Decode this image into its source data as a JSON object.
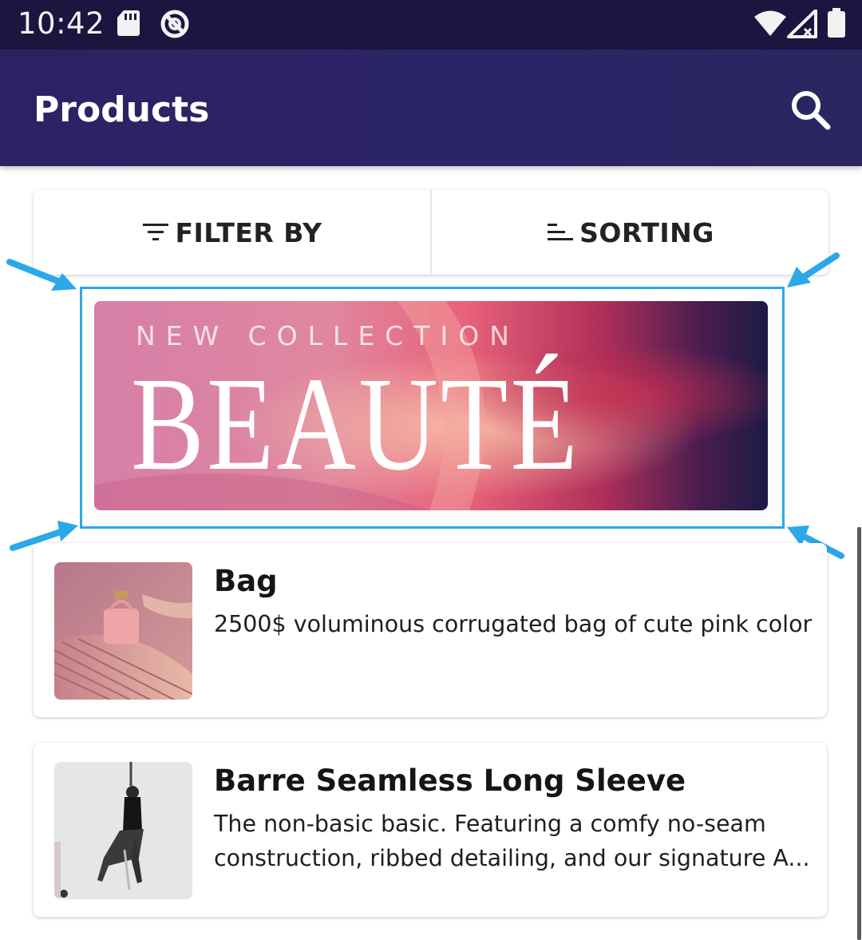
{
  "status_bar": {
    "time": "10:42",
    "icons": [
      "sd-card-icon",
      "do-not-disturb-icon",
      "wifi-icon",
      "signal-icon",
      "battery-icon"
    ]
  },
  "app_bar": {
    "title": "Products",
    "search_icon": "search-icon"
  },
  "toolbar": {
    "filter_label": "FILTER BY",
    "filter_icon": "filter-icon",
    "sort_label": "SORTING",
    "sort_icon": "sort-icon"
  },
  "banner": {
    "kicker": "NEW COLLECTION",
    "title": "BEAUTÉ",
    "highlight_color": "#2aa8e8"
  },
  "products": [
    {
      "name": "Bag",
      "description": "2500$ voluminous corrugated bag of cute pink color"
    },
    {
      "name": "Barre Seamless Long Sleeve",
      "description": "The non-basic basic. Featuring a comfy no-seam construction, ribbed detailing, and our signature A..."
    }
  ],
  "colors": {
    "status_bar": "#1a1640",
    "app_bar": "#2b2466",
    "accent_annotation": "#2aa8e8"
  }
}
